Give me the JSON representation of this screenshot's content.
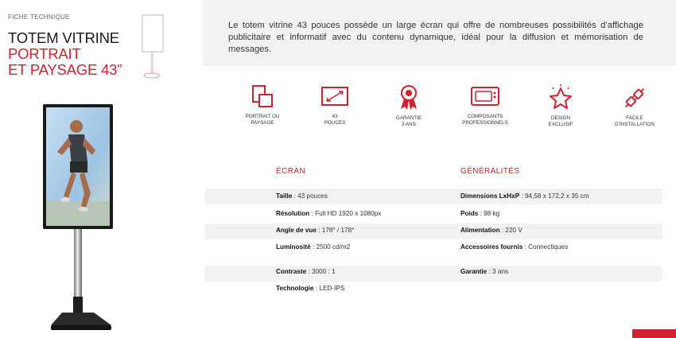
{
  "header": {
    "eyebrow": "FICHE TECHNIQUE",
    "title_line1": "TOTEM VITRINE",
    "title_line2": "PORTRAIT",
    "title_line3": "ET PAYSAGE 43”"
  },
  "intro": {
    "text": "Le totem vitrine 43 pouces possède un large écran qui offre de nombreuses possibilités d’affichage publicitaire et informatif avec du contenu dynamique, idéal pour la diffusion et mémorisation de messages."
  },
  "features": [
    {
      "icon": "rotate-screens-icon",
      "line1": "PORTRAIT OU",
      "line2": "PAYSAGE"
    },
    {
      "icon": "screen-size-icon",
      "line1": "43",
      "line2": "POUCES"
    },
    {
      "icon": "warranty-ribbon-icon",
      "line1": "GARANTIE",
      "line2": "3 ANS"
    },
    {
      "icon": "pro-components-icon",
      "line1": "COMPOSANTS",
      "line2": "PROFESSIONNELS"
    },
    {
      "icon": "star-design-icon",
      "line1": "DESIGN",
      "line2": "EXCLUSIF"
    },
    {
      "icon": "plug-install-icon",
      "line1": "FACILE",
      "line2": "D’INSTALLATION"
    }
  ],
  "specs": {
    "ecran_title": "ÉCRAN",
    "general_title": "GÉNÉRALITÉS",
    "ecran": [
      {
        "label": "Taille",
        "value": "43  pouces"
      },
      {
        "label": "Résolution",
        "value": "Full HD 1920 x 1080px"
      },
      {
        "label": "Angle de vue",
        "value": "178° / 178°"
      },
      {
        "label": "Luminosité",
        "value": "2500 cd/m2"
      },
      {
        "label": "Contraste",
        "value": "3000 : 1"
      },
      {
        "label": "Technologie",
        "value": "LED-IPS"
      }
    ],
    "general": [
      {
        "label": "Dimensions LxHxP",
        "value": "94,58 x 172,2 x 35 cm"
      },
      {
        "label": "Poids",
        "value": "98 kg"
      },
      {
        "label": "Alimentation",
        "value": "220 V"
      },
      {
        "label": "Accessoires fournis",
        "value": "Connectiques"
      },
      {
        "label": "Garantie",
        "value": "3 ans"
      }
    ]
  },
  "colors": {
    "accent": "#d32030",
    "band": "#f2f2f2"
  }
}
